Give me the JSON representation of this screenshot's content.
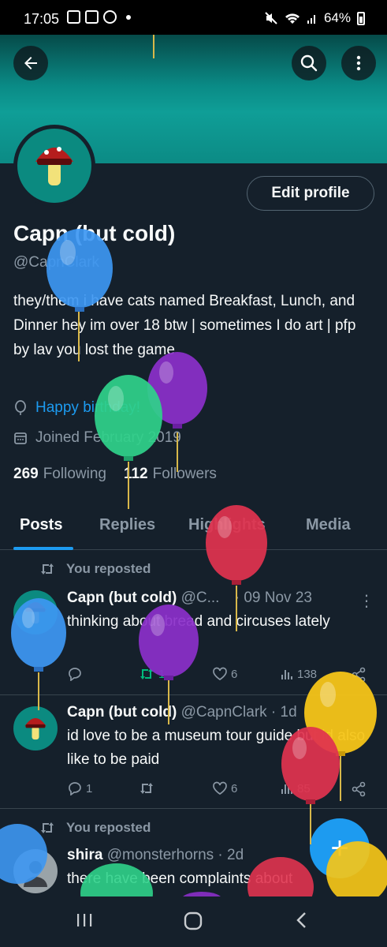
{
  "status_bar": {
    "time": "17:05",
    "battery": "64%"
  },
  "header": {
    "back_icon": "arrow-left-icon",
    "search_icon": "search-icon",
    "more_icon": "more-vertical-icon"
  },
  "profile": {
    "edit_label": "Edit profile",
    "name": "Capn (but cold)",
    "handle": "@CapnClark",
    "bio": "they/them  i have cats named Breakfast, Lunch, and Dinner  hey im over 18 btw | sometimes I do art | pfp by lav you lost the game",
    "birthday": "Happy birthday!",
    "joined": "Joined February 2019",
    "following_count": "269",
    "following_label": "Following",
    "followers_count": "112",
    "followers_label": "Followers"
  },
  "tabs": [
    {
      "label": "Posts"
    },
    {
      "label": "Replies"
    },
    {
      "label": "Highlights"
    },
    {
      "label": "Media"
    }
  ],
  "posts": [
    {
      "repost_label": "You reposted",
      "name": "Capn (but cold)",
      "handle": "@C...",
      "date": "· 09 Nov 23",
      "text": "thinking about bread and circuses lately",
      "replies": "",
      "reposts": "1",
      "likes": "6",
      "views": "138"
    },
    {
      "name": "Capn (but cold)",
      "handle": "@CapnClark · 1d",
      "text": "id love to be a museum tour guide but id also like to be paid",
      "replies": "1",
      "reposts": "",
      "likes": "6",
      "views": "85"
    },
    {
      "repost_label": "You reposted",
      "name": "shira",
      "handle": "@monsterhorns · 2d",
      "text": "there have been complaints about"
    }
  ],
  "fab": {
    "label": "+"
  },
  "colors": {
    "background": "#15202b",
    "accent": "#1d9bf0",
    "repost_green": "#00ba7c",
    "banner": "#0f9e97"
  }
}
